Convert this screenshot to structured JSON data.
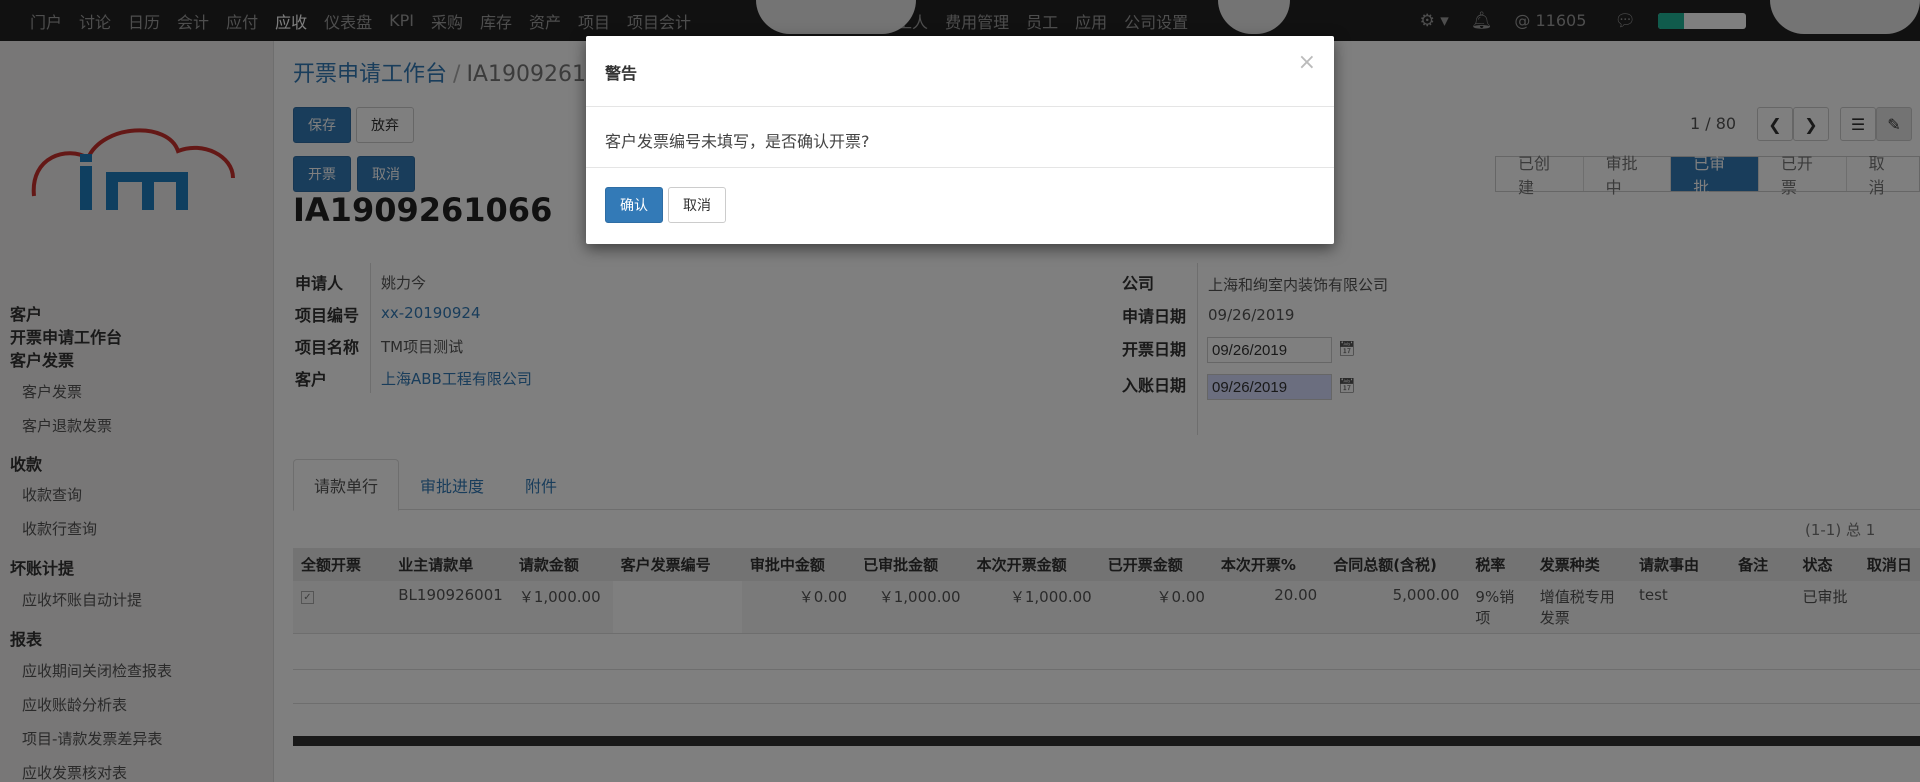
{
  "topnav": {
    "items": [
      "门户",
      "讨论",
      "日历",
      "会计",
      "应付",
      "应收",
      "仪表盘",
      "KPI",
      "采购",
      "库存",
      "资产",
      "项目",
      "项目会计"
    ],
    "items2": [
      "工人",
      "费用管理",
      "员工",
      "应用",
      "公司设置"
    ],
    "active": "应收",
    "message_count": "11605"
  },
  "sidebar": {
    "top": [
      "客户",
      "开票申请工作台",
      "客户发票"
    ],
    "groups": [
      {
        "title": null,
        "items": [
          "客户发票",
          "客户退款发票"
        ]
      },
      {
        "title": "收款",
        "items": [
          "收款查询",
          "收款行查询"
        ]
      },
      {
        "title": "坏账计提",
        "items": [
          "应收坏账自动计提"
        ]
      },
      {
        "title": "报表",
        "items": [
          "应收期间关闭检查报表",
          "应收账龄分析表",
          "项目-请款发票差异表",
          "应收发票核对表"
        ]
      }
    ]
  },
  "breadcrumb": {
    "parent": "开票申请工作台",
    "sep": "/",
    "current": "IA1909261"
  },
  "buttons": {
    "save": "保存",
    "discard": "放弃",
    "invoice": "开票",
    "cancel": "取消"
  },
  "pager": {
    "value": "1 / 80"
  },
  "stages": {
    "items": [
      "已创建",
      "审批中",
      "已审批",
      "已开票",
      "取消"
    ],
    "current": "已审批"
  },
  "record": {
    "name": "IA1909261066",
    "applicant_label": "申请人",
    "applicant": "姚力今",
    "project_code_label": "项目编号",
    "project_code": "xx-20190924",
    "project_name_label": "项目名称",
    "project_name": "TM项目测试",
    "customer_label": "客户",
    "customer": "上海ABB工程有限公司",
    "company_label": "公司",
    "company": "上海和绚室内装饰有限公司",
    "apply_date_label": "申请日期",
    "apply_date": "09/26/2019",
    "invoice_date_label": "开票日期",
    "invoice_date": "09/26/2019",
    "post_date_label": "入账日期",
    "post_date": "09/26/2019"
  },
  "tabs": [
    "请款单行",
    "审批进度",
    "附件"
  ],
  "table": {
    "count": "(1-1) 总 1",
    "headers": [
      "全额开票",
      "业主请款单",
      "请款金额",
      "客户发票编号",
      "审批中金额",
      "已审批金额",
      "本次开票金额",
      "已开票金额",
      "本次开票%",
      "合同总额(含税)",
      "税率",
      "发票种类",
      "请款事由",
      "备注",
      "状态",
      "取消日"
    ],
    "row": {
      "full": "✓",
      "req": "BL190926001",
      "amount": "￥1,000.00",
      "inv_no": "",
      "pending": "￥0.00",
      "approved": "￥1,000.00",
      "this_inv": "￥1,000.00",
      "invoiced": "￥0.00",
      "pct": "20.00",
      "contract": "5,000.00",
      "tax": "9%销项",
      "kind": "增值税专用发票",
      "reason": "test",
      "note": "",
      "status": "已审批",
      "cancel_date": ""
    }
  },
  "modal": {
    "title": "警告",
    "close": "×",
    "message": "客户发票编号未填写，是否确认开票?",
    "confirm": "确认",
    "cancel": "取消"
  },
  "colors": {
    "primary": "#337ab7",
    "topbar": "#222222",
    "progress": "#21b799"
  }
}
